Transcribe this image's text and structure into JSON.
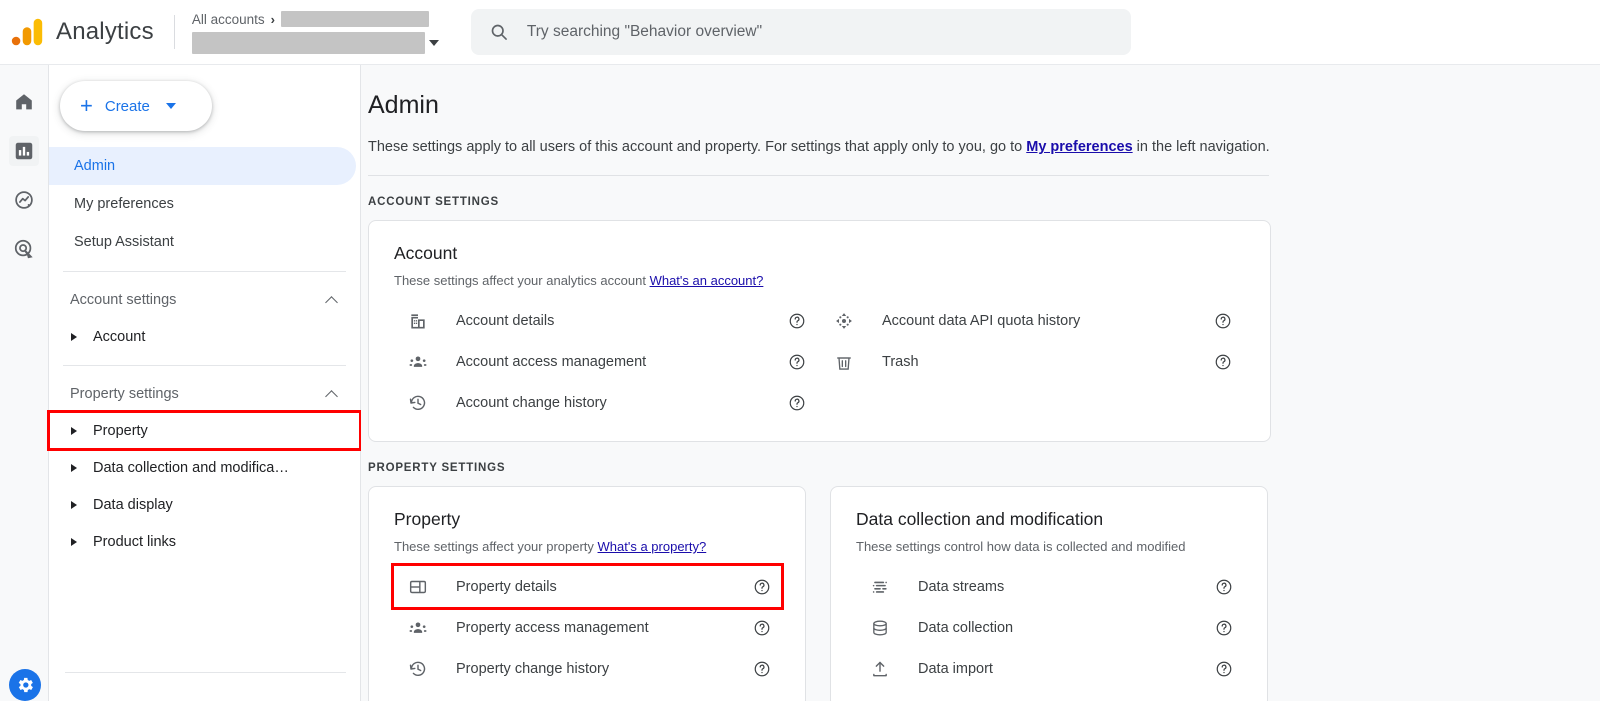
{
  "header": {
    "brand": "Analytics",
    "logo_colors": {
      "dot": "#e8710a",
      "mid": "#f29900",
      "tall": "#fbbc04"
    },
    "account_breadcrumb": "All accounts",
    "breadcrumb_separator": "›",
    "account_value_redacted": "",
    "property_value_redacted": "",
    "search": {
      "placeholder": "Try searching \"Behavior overview\"",
      "icon": "search-icon"
    }
  },
  "rail": {
    "items": [
      {
        "name": "home-icon",
        "label": "Home",
        "selected": false
      },
      {
        "name": "reports-icon",
        "label": "Reports",
        "selected": true
      },
      {
        "name": "explore-icon",
        "label": "Explore",
        "selected": false
      },
      {
        "name": "advertising-icon",
        "label": "Advertising",
        "selected": false
      }
    ],
    "bottom_badge": {
      "name": "gear-icon",
      "label": "Admin",
      "color": "#1a73e8"
    }
  },
  "sidebar": {
    "create_button": {
      "label": "Create",
      "icon": "plus-icon",
      "caret": "chevron-down-icon"
    },
    "nav": [
      {
        "label": "Admin",
        "active": true
      },
      {
        "label": "My preferences",
        "active": false
      },
      {
        "label": "Setup Assistant",
        "active": false
      }
    ],
    "groups": [
      {
        "label": "Account settings",
        "expanded": true,
        "items": [
          {
            "label": "Account",
            "highlighted": false
          }
        ]
      },
      {
        "label": "Property settings",
        "expanded": true,
        "items": [
          {
            "label": "Property",
            "highlighted": true
          },
          {
            "label": "Data collection and modifica…",
            "highlighted": false
          },
          {
            "label": "Data display",
            "highlighted": false
          },
          {
            "label": "Product links",
            "highlighted": false
          }
        ]
      }
    ]
  },
  "main": {
    "title": "Admin",
    "description_before": "These settings apply to all users of this account and property. For settings that apply only to you, go to ",
    "description_link": "My preferences",
    "description_after": " in the left navigation.",
    "sections": [
      {
        "label": "ACCOUNT SETTINGS",
        "cards": [
          {
            "title": "Account",
            "subtitle_text": "These settings affect your analytics account ",
            "subtitle_link": "What's an account?",
            "layout": "two-column",
            "columns": [
              {
                "rows": [
                  {
                    "label": "Account details",
                    "icon": "building-icon",
                    "help": "help-icon",
                    "highlighted": false
                  },
                  {
                    "label": "Account access management",
                    "icon": "people-icon",
                    "help": "help-icon",
                    "highlighted": false
                  },
                  {
                    "label": "Account change history",
                    "icon": "history-icon",
                    "help": "help-icon",
                    "highlighted": false
                  }
                ]
              },
              {
                "rows": [
                  {
                    "label": "Account data API quota history",
                    "icon": "quota-icon",
                    "help": "help-icon",
                    "highlighted": false
                  },
                  {
                    "label": "Trash",
                    "icon": "trash-icon",
                    "help": "help-icon",
                    "highlighted": false
                  }
                ]
              }
            ]
          }
        ]
      },
      {
        "label": "PROPERTY SETTINGS",
        "cards": [
          {
            "title": "Property",
            "subtitle_text": "These settings affect your property ",
            "subtitle_link": "What's a property?",
            "layout": "single-column",
            "rows": [
              {
                "label": "Property details",
                "icon": "property-details-icon",
                "help": "help-icon",
                "highlighted": true
              },
              {
                "label": "Property access management",
                "icon": "people-icon",
                "help": "help-icon",
                "highlighted": false
              },
              {
                "label": "Property change history",
                "icon": "history-icon",
                "help": "help-icon",
                "highlighted": false
              }
            ]
          },
          {
            "title": "Data collection and modification",
            "subtitle_text": "These settings control how data is collected and modified",
            "subtitle_link": "",
            "layout": "single-column",
            "rows": [
              {
                "label": "Data streams",
                "icon": "data-streams-icon",
                "help": "help-icon",
                "highlighted": false
              },
              {
                "label": "Data collection",
                "icon": "database-icon",
                "help": "help-icon",
                "highlighted": false
              },
              {
                "label": "Data import",
                "icon": "upload-icon",
                "help": "help-icon",
                "highlighted": false
              }
            ]
          }
        ]
      }
    ]
  },
  "colors": {
    "accent_blue": "#1a73e8",
    "highlight_red": "#ff0000",
    "link_blue": "#1a0dab",
    "page_bg": "#f8f9fa"
  }
}
